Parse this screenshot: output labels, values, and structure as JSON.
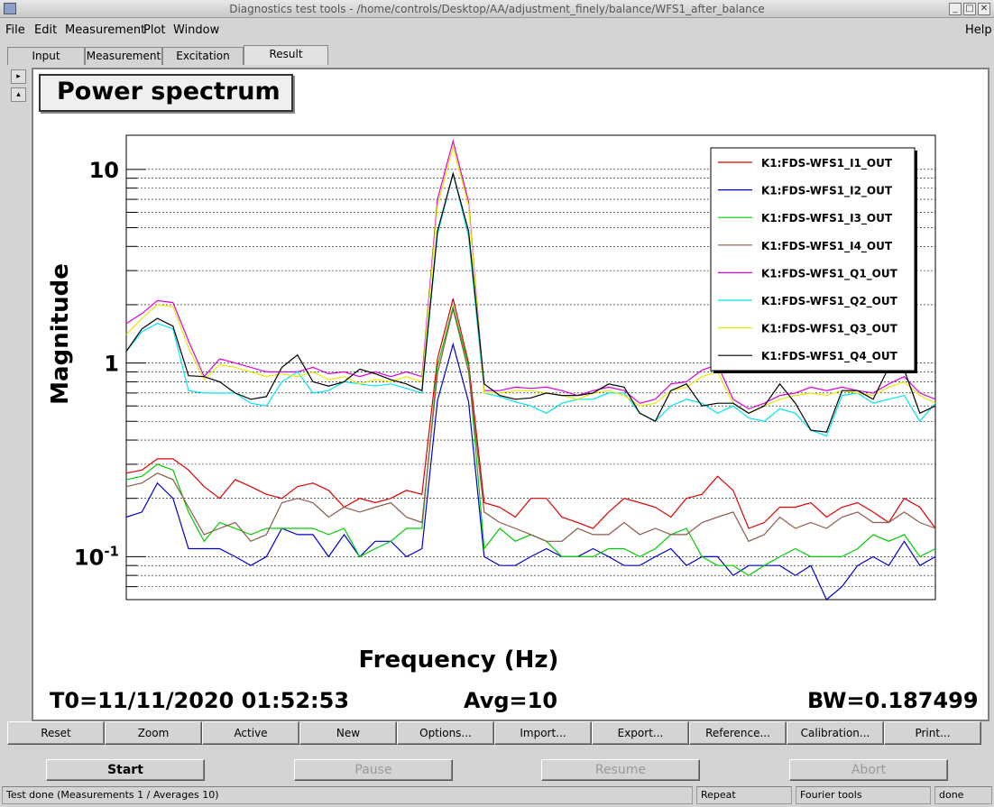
{
  "window": {
    "title": "Diagnostics test tools - /home/controls/Desktop/AA/adjustment_finely/balance/WFS1_after_balance",
    "minimize_glyph": "_",
    "maximize_glyph": "□",
    "close_glyph": "✕"
  },
  "menu": {
    "file": "File",
    "edit": "Edit",
    "measurement": "Measurement",
    "plot": "Plot",
    "window": "Window",
    "help": "Help"
  },
  "tabs": [
    "Input",
    "Measurement",
    "Excitation",
    "Result"
  ],
  "active_tab": "Result",
  "side_arrows": {
    "right": "▸",
    "up": "▴"
  },
  "plot_title": "Power spectrum",
  "chart_data": {
    "type": "line",
    "title": "",
    "xlabel": "Frequency (Hz)",
    "ylabel": "Magnitude",
    "y_scale": "log",
    "ylim": [
      0.06,
      15
    ],
    "y_ticks": [
      {
        "value": 10,
        "label": "10"
      },
      {
        "value": 1,
        "label": "1"
      },
      {
        "value": 0.1,
        "label": "10^-1"
      }
    ],
    "grid": "horizontal",
    "legend_position": "top-right",
    "series": [
      {
        "name": "K1:FDS-WFS1_I1_OUT",
        "color": "#e00000",
        "values": [
          0.27,
          0.28,
          0.32,
          0.32,
          0.28,
          0.23,
          0.2,
          0.25,
          0.23,
          0.21,
          0.2,
          0.23,
          0.24,
          0.22,
          0.18,
          0.2,
          0.19,
          0.2,
          0.22,
          0.21,
          1.05,
          2.15,
          1.0,
          0.19,
          0.18,
          0.16,
          0.2,
          0.2,
          0.16,
          0.15,
          0.14,
          0.17,
          0.2,
          0.19,
          0.18,
          0.16,
          0.2,
          0.21,
          0.26,
          0.22,
          0.14,
          0.15,
          0.18,
          0.18,
          0.19,
          0.16,
          0.18,
          0.19,
          0.17,
          0.15,
          0.2,
          0.18,
          0.14
        ]
      },
      {
        "name": "K1:FDS-WFS1_I2_OUT",
        "color": "#0000cc",
        "values": [
          0.16,
          0.17,
          0.24,
          0.2,
          0.11,
          0.11,
          0.11,
          0.1,
          0.09,
          0.1,
          0.14,
          0.13,
          0.13,
          0.1,
          0.13,
          0.1,
          0.12,
          0.12,
          0.1,
          0.11,
          0.64,
          1.25,
          0.63,
          0.1,
          0.09,
          0.09,
          0.1,
          0.11,
          0.1,
          0.1,
          0.11,
          0.1,
          0.09,
          0.09,
          0.1,
          0.11,
          0.09,
          0.1,
          0.1,
          0.08,
          0.09,
          0.09,
          0.09,
          0.08,
          0.09,
          0.06,
          0.07,
          0.09,
          0.1,
          0.09,
          0.12,
          0.09,
          0.1
        ]
      },
      {
        "name": "K1:FDS-WFS1_I3_OUT",
        "color": "#00cc00",
        "values": [
          0.25,
          0.26,
          0.3,
          0.28,
          0.17,
          0.12,
          0.15,
          0.14,
          0.13,
          0.14,
          0.14,
          0.14,
          0.14,
          0.13,
          0.14,
          0.1,
          0.11,
          0.12,
          0.14,
          0.14,
          0.96,
          1.95,
          0.96,
          0.11,
          0.14,
          0.12,
          0.13,
          0.12,
          0.1,
          0.1,
          0.1,
          0.11,
          0.11,
          0.1,
          0.11,
          0.13,
          0.14,
          0.1,
          0.09,
          0.09,
          0.08,
          0.09,
          0.1,
          0.11,
          0.1,
          0.1,
          0.1,
          0.11,
          0.13,
          0.12,
          0.13,
          0.1,
          0.11
        ]
      },
      {
        "name": "K1:FDS-WFS1_I4_OUT",
        "color": "#8b5a4a",
        "values": [
          0.23,
          0.24,
          0.27,
          0.25,
          0.18,
          0.13,
          0.14,
          0.15,
          0.12,
          0.13,
          0.19,
          0.2,
          0.19,
          0.16,
          0.18,
          0.17,
          0.18,
          0.19,
          0.16,
          0.15,
          0.88,
          1.9,
          0.9,
          0.17,
          0.15,
          0.14,
          0.13,
          0.12,
          0.12,
          0.14,
          0.13,
          0.13,
          0.15,
          0.13,
          0.14,
          0.13,
          0.13,
          0.15,
          0.16,
          0.17,
          0.12,
          0.13,
          0.16,
          0.14,
          0.15,
          0.14,
          0.16,
          0.17,
          0.15,
          0.15,
          0.17,
          0.15,
          0.14
        ]
      },
      {
        "name": "K1:FDS-WFS1_Q1_OUT",
        "color": "#dd00dd",
        "values": [
          1.6,
          1.8,
          2.1,
          2.05,
          1.3,
          0.85,
          1.05,
          1.0,
          0.95,
          0.9,
          0.9,
          0.9,
          0.95,
          0.88,
          0.9,
          0.85,
          0.9,
          0.85,
          0.9,
          0.85,
          7.0,
          14.0,
          6.8,
          0.72,
          0.72,
          0.75,
          0.74,
          0.75,
          0.72,
          0.68,
          0.72,
          0.75,
          0.72,
          0.62,
          0.65,
          0.78,
          0.8,
          0.92,
          0.98,
          0.65,
          0.58,
          0.62,
          0.68,
          0.7,
          0.75,
          0.72,
          0.75,
          0.72,
          0.7,
          0.78,
          0.85,
          0.7,
          0.65
        ]
      },
      {
        "name": "K1:FDS-WFS1_Q2_OUT",
        "color": "#00e5ee",
        "values": [
          1.15,
          1.45,
          1.6,
          1.5,
          0.72,
          0.7,
          0.7,
          0.7,
          0.62,
          0.6,
          0.8,
          0.9,
          0.7,
          0.72,
          0.8,
          0.78,
          0.76,
          0.78,
          0.74,
          0.7,
          4.6,
          9.6,
          4.5,
          0.7,
          0.67,
          0.63,
          0.6,
          0.55,
          0.62,
          0.65,
          0.65,
          0.7,
          0.7,
          0.55,
          0.5,
          0.6,
          0.65,
          0.62,
          0.55,
          0.6,
          0.52,
          0.5,
          0.58,
          0.55,
          0.45,
          0.42,
          0.68,
          0.7,
          0.62,
          0.65,
          0.68,
          0.5,
          0.62
        ]
      },
      {
        "name": "K1:FDS-WFS1_Q3_OUT",
        "color": "#e8e800",
        "values": [
          1.4,
          1.7,
          2.0,
          1.95,
          1.2,
          0.82,
          0.98,
          0.95,
          0.9,
          0.85,
          0.88,
          0.85,
          0.9,
          0.82,
          0.85,
          0.78,
          0.82,
          0.8,
          0.85,
          0.8,
          6.5,
          13.0,
          6.5,
          0.7,
          0.7,
          0.72,
          0.72,
          0.7,
          0.68,
          0.65,
          0.7,
          0.72,
          0.68,
          0.6,
          0.62,
          0.72,
          0.75,
          0.85,
          0.9,
          0.62,
          0.55,
          0.6,
          0.65,
          0.68,
          0.7,
          0.68,
          0.72,
          0.7,
          0.68,
          0.75,
          0.8,
          0.68,
          0.62
        ]
      },
      {
        "name": "K1:FDS-WFS1_Q4_OUT",
        "color": "#000000",
        "values": [
          1.15,
          1.5,
          1.7,
          1.55,
          0.86,
          0.85,
          0.8,
          0.7,
          0.65,
          0.67,
          0.95,
          1.1,
          0.8,
          0.76,
          0.8,
          0.93,
          0.88,
          0.82,
          0.78,
          0.72,
          4.8,
          9.5,
          4.8,
          0.78,
          0.68,
          0.65,
          0.66,
          0.7,
          0.68,
          0.68,
          0.7,
          0.78,
          0.75,
          0.55,
          0.5,
          0.72,
          0.78,
          0.6,
          0.62,
          0.62,
          0.55,
          0.6,
          0.78,
          0.62,
          0.45,
          0.44,
          0.72,
          0.72,
          0.65,
          0.95,
          0.92,
          0.55,
          0.6
        ]
      }
    ]
  },
  "footer": {
    "t0": "T0=11/11/2020 01:52:53",
    "avg": "Avg=10",
    "bw": "BW=0.187499"
  },
  "buttons": [
    "Reset",
    "Zoom",
    "Active",
    "New",
    "Options...",
    "Import...",
    "Export...",
    "Reference...",
    "Calibration...",
    "Print..."
  ],
  "run_buttons": {
    "start": "Start",
    "pause": "Pause",
    "resume": "Resume",
    "abort": "Abort"
  },
  "status": {
    "message": "Test done (Measurements 1 / Averages 10)",
    "mode": "Repeat",
    "tool": "Fourier tools",
    "state": "done"
  }
}
